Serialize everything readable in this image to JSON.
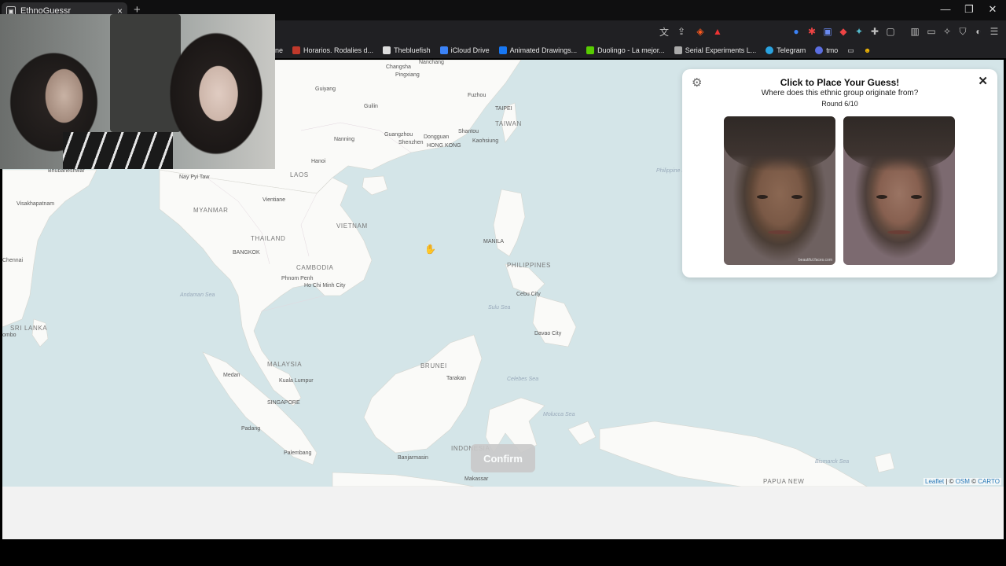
{
  "browser": {
    "tab_title": "EthnoGuessr",
    "tab_close": "×",
    "new_tab": "+",
    "window_controls": [
      "—",
      "❐",
      "✕"
    ],
    "bookmarks": [
      {
        "label": "ne",
        "icon_color": "#888888"
      },
      {
        "label": "Horarios. Rodalies d...",
        "icon_color": "#c0392b"
      },
      {
        "label": "Thebluefish",
        "icon_color": "#dddddd"
      },
      {
        "label": "iCloud Drive",
        "icon_color": "#3b82f6"
      },
      {
        "label": "Animated Drawings...",
        "icon_color": "#1877f2"
      },
      {
        "label": "Duolingo - La mejor...",
        "icon_color": "#58cc02"
      },
      {
        "label": "Serial Experiments L...",
        "icon_color": "#aaaaaa"
      },
      {
        "label": "Telegram",
        "icon_color": "#2aa3e0"
      },
      {
        "label": "tmo",
        "icon_color": "#5b6ee1"
      }
    ]
  },
  "map": {
    "places": [
      {
        "label": "Nanchang",
        "cls": "place"
      },
      {
        "label": "Changsha",
        "cls": "place"
      },
      {
        "label": "Pingxiang",
        "cls": "place"
      },
      {
        "label": "Guiyang",
        "cls": "place"
      },
      {
        "label": "Guilin",
        "cls": "place"
      },
      {
        "label": "Fuzhou",
        "cls": "place"
      },
      {
        "label": "TAIPEI",
        "cls": "place"
      },
      {
        "label": "TAIWAN",
        "cls": "country"
      },
      {
        "label": "Guangzhou",
        "cls": "place"
      },
      {
        "label": "Dongguan",
        "cls": "place"
      },
      {
        "label": "Shantou",
        "cls": "place"
      },
      {
        "label": "Shenzhen",
        "cls": "place"
      },
      {
        "label": "HONG KONG",
        "cls": "place"
      },
      {
        "label": "Kaohsiung",
        "cls": "place"
      },
      {
        "label": "Nanning",
        "cls": "place"
      },
      {
        "label": "Hanoi",
        "cls": "place"
      },
      {
        "label": "Bhubaneshwar",
        "cls": "place"
      },
      {
        "label": "Nay Pyi Taw",
        "cls": "place"
      },
      {
        "label": "LAOS",
        "cls": "country"
      },
      {
        "label": "Vientiane",
        "cls": "place"
      },
      {
        "label": "MYANMAR",
        "cls": "country"
      },
      {
        "label": "Visakhapatnam",
        "cls": "place"
      },
      {
        "label": "THAILAND",
        "cls": "country"
      },
      {
        "label": "VIETNAM",
        "cls": "country"
      },
      {
        "label": "MANILA",
        "cls": "place"
      },
      {
        "label": "BANGKOK",
        "cls": "place"
      },
      {
        "label": "Chennai",
        "cls": "place"
      },
      {
        "label": "CAMBODIA",
        "cls": "country"
      },
      {
        "label": "PHILIPPINES",
        "cls": "country"
      },
      {
        "label": "Phnom Penh",
        "cls": "place"
      },
      {
        "label": "Ho Chi Minh City",
        "cls": "place"
      },
      {
        "label": "Andaman Sea",
        "cls": "sea"
      },
      {
        "label": "Cebu City",
        "cls": "place"
      },
      {
        "label": "Sulu Sea",
        "cls": "sea"
      },
      {
        "label": "SRI LANKA",
        "cls": "country"
      },
      {
        "label": "ombo",
        "cls": "place"
      },
      {
        "label": "Davao City",
        "cls": "place"
      },
      {
        "label": "MALAYSIA",
        "cls": "country"
      },
      {
        "label": "BRUNEI",
        "cls": "country"
      },
      {
        "label": "Medan",
        "cls": "place"
      },
      {
        "label": "Kuala Lumpur",
        "cls": "place"
      },
      {
        "label": "Tarakan",
        "cls": "place"
      },
      {
        "label": "Celebes Sea",
        "cls": "sea"
      },
      {
        "label": "SINGAPORE",
        "cls": "place"
      },
      {
        "label": "Molucca Sea",
        "cls": "sea"
      },
      {
        "label": "Padang",
        "cls": "place"
      },
      {
        "label": "Palembang",
        "cls": "place"
      },
      {
        "label": "INDONESIA",
        "cls": "country"
      },
      {
        "label": "Banjarmasin",
        "cls": "place"
      },
      {
        "label": "Bismarck Sea",
        "cls": "sea"
      },
      {
        "label": "Makassar",
        "cls": "place"
      },
      {
        "label": "PAPUA NEW",
        "cls": "country"
      },
      {
        "label": "Philippine Sea",
        "cls": "sea"
      }
    ],
    "attribution": {
      "leaflet": "Leaflet",
      "sep": " | © ",
      "osm": "OSM",
      "copy": " © ",
      "carto": "CARTO"
    },
    "confirm_label": "Confirm"
  },
  "panel": {
    "title": "Click to Place Your Guess!",
    "question": "Where does this ethnic group originate from?",
    "round": "Round 6/10",
    "close_label": "✕",
    "gear_icon": "⚙",
    "face_watermark": "beautiful.faces.com"
  }
}
